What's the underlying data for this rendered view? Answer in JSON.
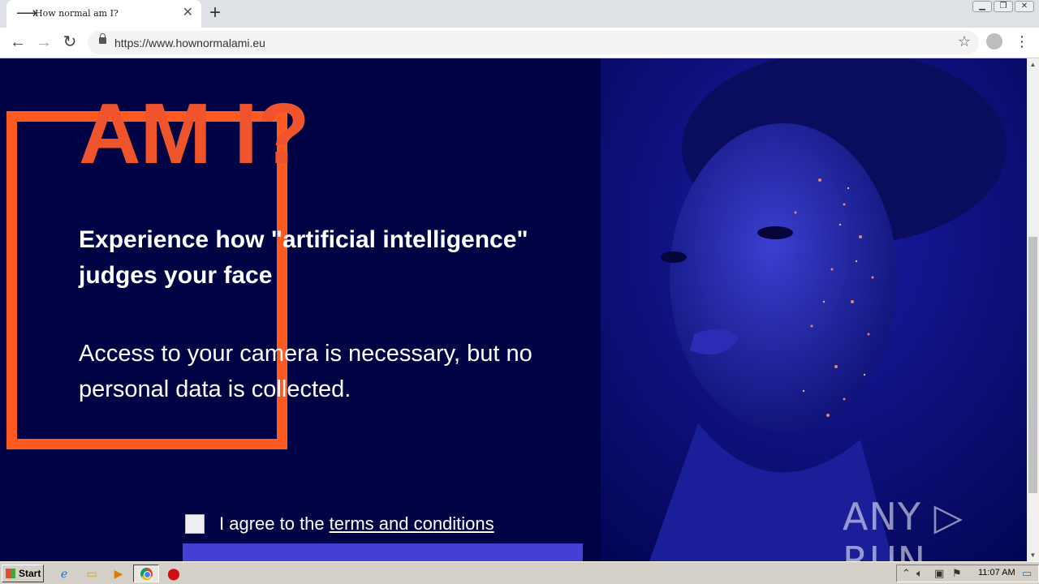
{
  "browser": {
    "tab_title": "How normal am I?",
    "tab_icon": "arrow-right-icon",
    "url": "https://www.hownormalami.eu"
  },
  "page": {
    "heading": "AM I?",
    "tagline": "Experience how \"artificial intelligence\" judges your face",
    "notice": "Access to your camera is necessary, but no personal data is collected.",
    "agree_prefix": "I agree to the",
    "terms_link": "terms and conditions",
    "watermark": "ANY ▷ RUN"
  },
  "colors": {
    "background": "#000343",
    "accent": "#f0542c",
    "frame": "#ff5a1f",
    "button": "#4440d6"
  },
  "taskbar": {
    "start_label": "Start",
    "clock": "11:07 AM"
  }
}
